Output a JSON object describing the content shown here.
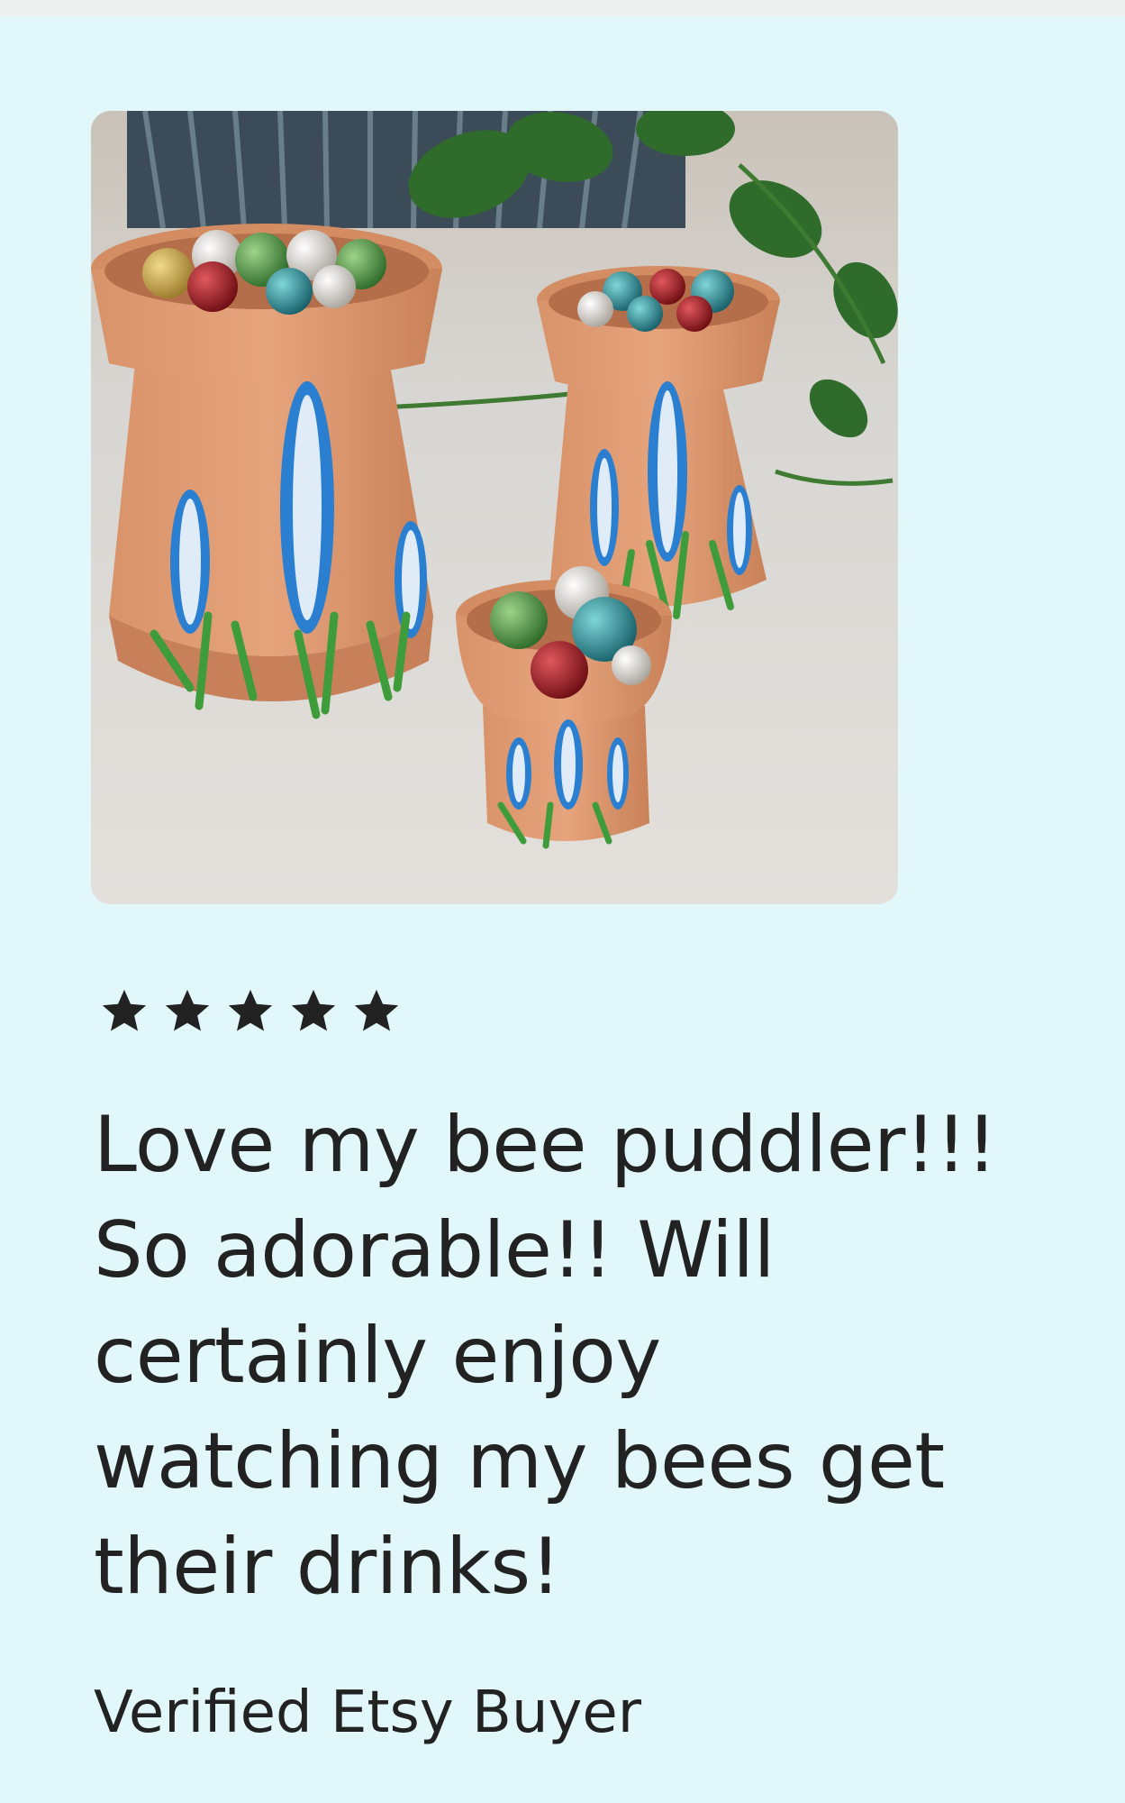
{
  "review": {
    "image_alt": "Three terracotta bee puddlers painted with blue flowers, filled with glass marbles",
    "rating": 5,
    "rating_max": 5,
    "star_color": "#222222",
    "text": "Love my bee puddler!!!\nSo adorable!! Will\ncertainly enjoy\nwatching my bees get\ntheir drinks!",
    "reviewer": "Verified Etsy Buyer"
  },
  "colors": {
    "background": "#e1f7fa",
    "text": "#222222"
  }
}
